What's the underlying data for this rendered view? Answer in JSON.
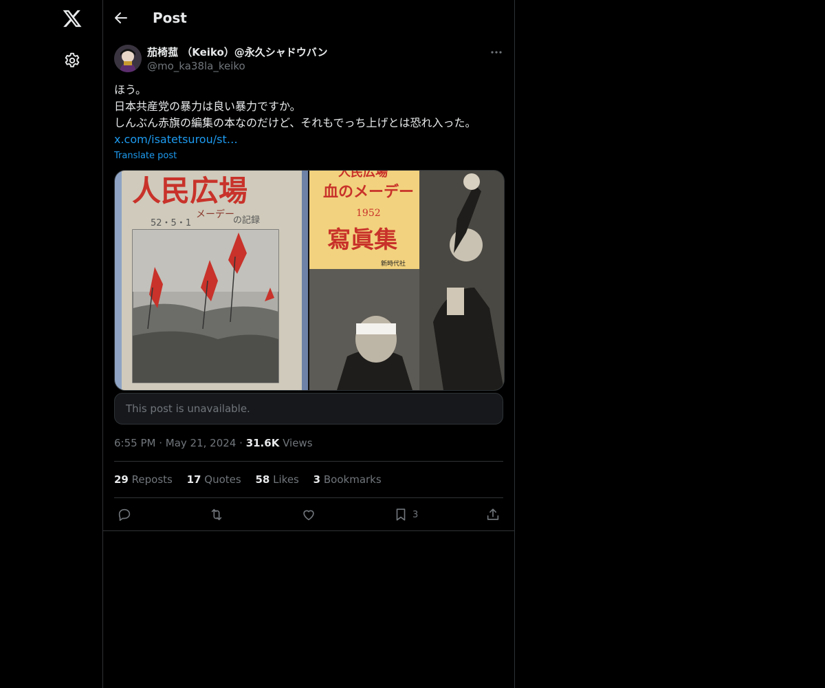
{
  "nav": {
    "logo_icon": "x-logo-icon",
    "settings_icon": "gear-icon"
  },
  "header": {
    "title": "Post"
  },
  "post": {
    "author_name": "茄椅菰 （Keiko）@永久シャドウバン",
    "author_handle": "@mo_ka38la_keiko",
    "lines": [
      "ほう。",
      "日本共産党の暴力は良い暴力ですか。",
      "しんぶん赤旗の編集の本なのだけど、それもでっち上げとは恐れ入った。"
    ],
    "link": "x.com/isatetsurou/st…",
    "translate": "Translate post",
    "images": {
      "left": {
        "title": "人民広場",
        "subtitle": "メーデー",
        "date": "52・5・1",
        "caption": "の記録"
      },
      "right": {
        "top": "人民広場",
        "headline": "血のメーデー",
        "year": "1952",
        "title": "寫眞集",
        "publisher": "新時代社"
      }
    },
    "quoted_unavailable": "This post is unavailable.",
    "time": "6:55 PM",
    "date": "May 21, 2024",
    "views_count": "31.6K",
    "views_label": "Views",
    "stats": {
      "reposts": "29",
      "reposts_label": "Reposts",
      "quotes": "17",
      "quotes_label": "Quotes",
      "likes": "58",
      "likes_label": "Likes",
      "bookmarks": "3",
      "bookmarks_label": "Bookmarks"
    },
    "actions": {
      "bookmark_count": "3"
    }
  },
  "colors": {
    "background": "#000000",
    "text": "#e7e9ea",
    "muted": "#71767b",
    "link": "#1d9bf0",
    "border": "#2f3336"
  }
}
